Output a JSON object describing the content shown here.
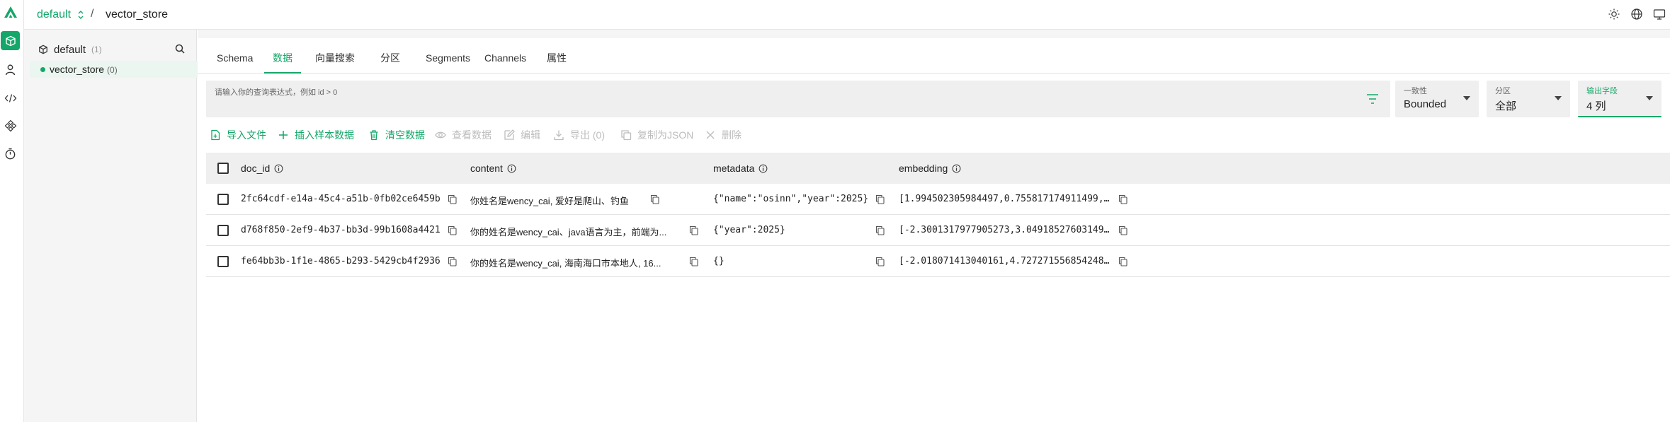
{
  "colors": {
    "accent": "#14a769",
    "disabled": "#bdbdbd",
    "panel_bg": "#f5f5f5",
    "field_bg": "#efefef"
  },
  "header": {
    "database": "default",
    "separator": "/",
    "collection": "vector_store",
    "icons": [
      "theme-sun-icon",
      "language-globe-icon",
      "monitor-icon"
    ]
  },
  "sidebar_rail": {
    "icons": [
      "milvus-logo-icon",
      "database-cube-icon",
      "user-icon",
      "code-icon",
      "cluster-icon",
      "timer-icon"
    ]
  },
  "tree": {
    "root_label": "default",
    "root_count": "(1)",
    "items": [
      {
        "label": "vector_store",
        "count": "(0)"
      }
    ]
  },
  "tabs": [
    {
      "label": "Schema"
    },
    {
      "label": "数据"
    },
    {
      "label": "向量搜索"
    },
    {
      "label": "分区"
    },
    {
      "label": "Segments"
    },
    {
      "label": "Channels"
    },
    {
      "label": "属性"
    }
  ],
  "query": {
    "placeholder": "请输入你的查询表达式，例如 id > 0"
  },
  "selects": [
    {
      "label": "一致性",
      "value": "Bounded"
    },
    {
      "label": "分区",
      "value": "全部"
    },
    {
      "label": "输出字段",
      "value": "4 列"
    }
  ],
  "toolbar": [
    {
      "label": "导入文件",
      "icon": "file-import-icon",
      "enabled": true
    },
    {
      "label": "插入样本数据",
      "icon": "plus-icon",
      "enabled": true
    },
    {
      "label": "清空数据",
      "icon": "trash-icon",
      "enabled": true
    },
    {
      "label": "查看数据",
      "icon": "eye-icon",
      "enabled": false
    },
    {
      "label": "编辑",
      "icon": "edit-icon",
      "enabled": false
    },
    {
      "label": "导出 (0)",
      "icon": "download-icon",
      "enabled": false
    },
    {
      "label": "复制为JSON",
      "icon": "copy-icon",
      "enabled": false
    },
    {
      "label": "删除",
      "icon": "close-icon",
      "enabled": false
    }
  ],
  "table": {
    "columns": [
      "doc_id",
      "content",
      "metadata",
      "embedding"
    ],
    "rows": [
      {
        "doc_id": "2fc64cdf-e14a-45c4-a51b-0fb02ce6459b",
        "content": "你姓名是wency_cai, 爱好是爬山、钓鱼",
        "metadata": "{\"name\":\"osinn\",\"year\":2025}",
        "embedding": "[1.994502305984497,0.755817174911499,..."
      },
      {
        "doc_id": "d768f850-2ef9-4b37-bb3d-99b1608a4421",
        "content": "你的姓名是wency_cai、java语言为主，前端为...",
        "metadata": "{\"year\":2025}",
        "embedding": "[-2.3001317977905273,3.04918527603149..."
      },
      {
        "doc_id": "fe64bb3b-1f1e-4865-b293-5429cb4f2936",
        "content": "你的姓名是wency_cai, 海南海口市本地人, 16...",
        "metadata": "{}",
        "embedding": "[-2.018071413040161,4.727271556854248..."
      }
    ]
  }
}
